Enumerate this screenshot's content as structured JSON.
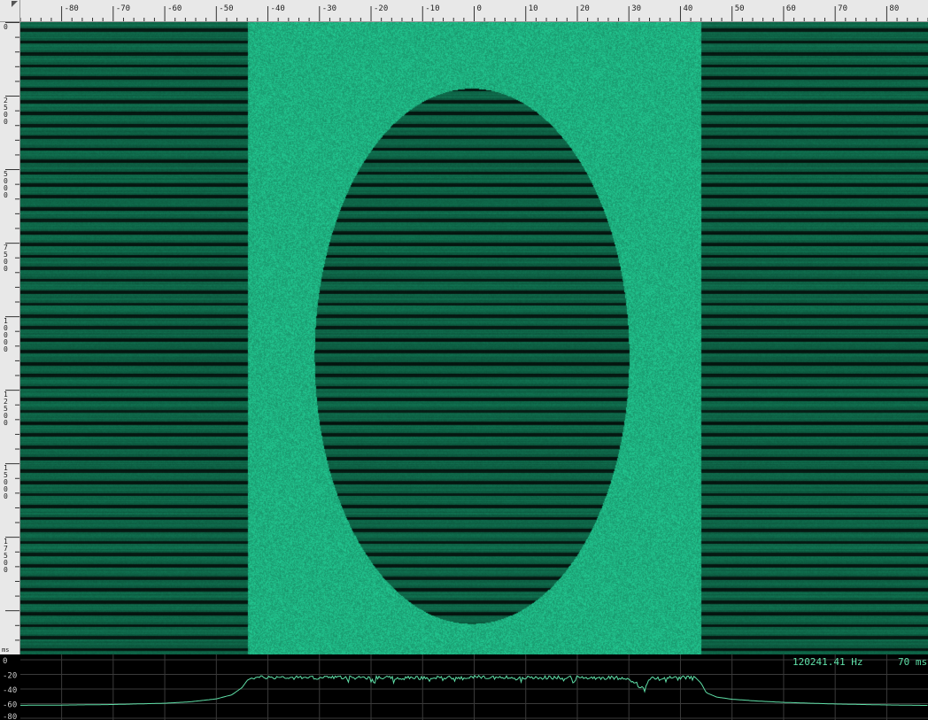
{
  "window": {
    "title": ""
  },
  "colors": {
    "ruler_bg": "#e8e8e8",
    "ruler_tick": "#333333",
    "noise_bright": "#1fb583",
    "band_dark": "#0b2e22",
    "band_mid": "#0f6a4b",
    "trace": "#5fe0a8",
    "grid": "#3a3a3a"
  },
  "readout": {
    "frequency": "120241.41 Hz",
    "time": "70 ms"
  },
  "chart_data": [
    {
      "type": "heatmap",
      "title": "",
      "x_axis": {
        "label": "",
        "range": [
          -88,
          88
        ],
        "tick_labels": [
          "-80",
          "-70",
          "-60",
          "-50",
          "-40",
          "-30",
          "-20",
          "-10",
          "0",
          "10",
          "20",
          "30",
          "40",
          "50",
          "60",
          "70",
          "80"
        ],
        "minor_step": 2
      },
      "y_axis": {
        "label": "ms",
        "range": [
          0,
          21500
        ],
        "tick_labels": [
          "0",
          "2500",
          "5000",
          "7500",
          "10000",
          "12500",
          "15000",
          "17500"
        ],
        "minor_step": 500
      },
      "regions": [
        {
          "name": "left band block",
          "x_range": [
            -88,
            -44
          ],
          "pattern": "horizontal stripes"
        },
        {
          "name": "center noise field",
          "x_range": [
            -44,
            44
          ],
          "pattern": "uniform noise"
        },
        {
          "name": "right band block",
          "x_range": [
            44,
            88
          ],
          "pattern": "horizontal stripes"
        },
        {
          "name": "central ellipse",
          "center": [
            -0.5,
            11350
          ],
          "radius_x": 30.5,
          "radius_y": 9100,
          "pattern": "horizontal stripes"
        }
      ],
      "stripe_period_ms": 405
    },
    {
      "type": "line",
      "title": "",
      "x_axis": {
        "range": [
          -88,
          88
        ]
      },
      "y_axis": {
        "label": "",
        "range": [
          -80,
          0
        ],
        "tick_labels": [
          "0",
          "-20",
          "-40",
          "-60",
          "-80"
        ]
      },
      "series": [
        {
          "name": "",
          "points": [
            [
              -88,
              -62.3
            ],
            [
              -80,
              -62.0
            ],
            [
              -70,
              -61.2
            ],
            [
              -60,
              -59.5
            ],
            [
              -55,
              -57.5
            ],
            [
              -50,
              -53.5
            ],
            [
              -47,
              -48.0
            ],
            [
              -45,
              -38.0
            ],
            [
              -44,
              -28.0
            ],
            [
              -43,
              -24.5
            ],
            [
              -40,
              -24.0
            ],
            [
              -30,
              -24.5
            ],
            [
              -20,
              -24.2
            ],
            [
              -10,
              -24.8
            ],
            [
              0,
              -24.0
            ],
            [
              10,
              -24.6
            ],
            [
              20,
              -24.3
            ],
            [
              30,
              -24.8
            ],
            [
              33,
              -41.0
            ],
            [
              34,
              -25.0
            ],
            [
              40,
              -24.2
            ],
            [
              43,
              -25.0
            ],
            [
              44,
              -32.0
            ],
            [
              45,
              -45.0
            ],
            [
              47,
              -51.0
            ],
            [
              50,
              -54.0
            ],
            [
              55,
              -56.5
            ],
            [
              60,
              -58.3
            ],
            [
              70,
              -60.5
            ],
            [
              80,
              -61.8
            ],
            [
              88,
              -62.5
            ]
          ]
        }
      ]
    }
  ]
}
